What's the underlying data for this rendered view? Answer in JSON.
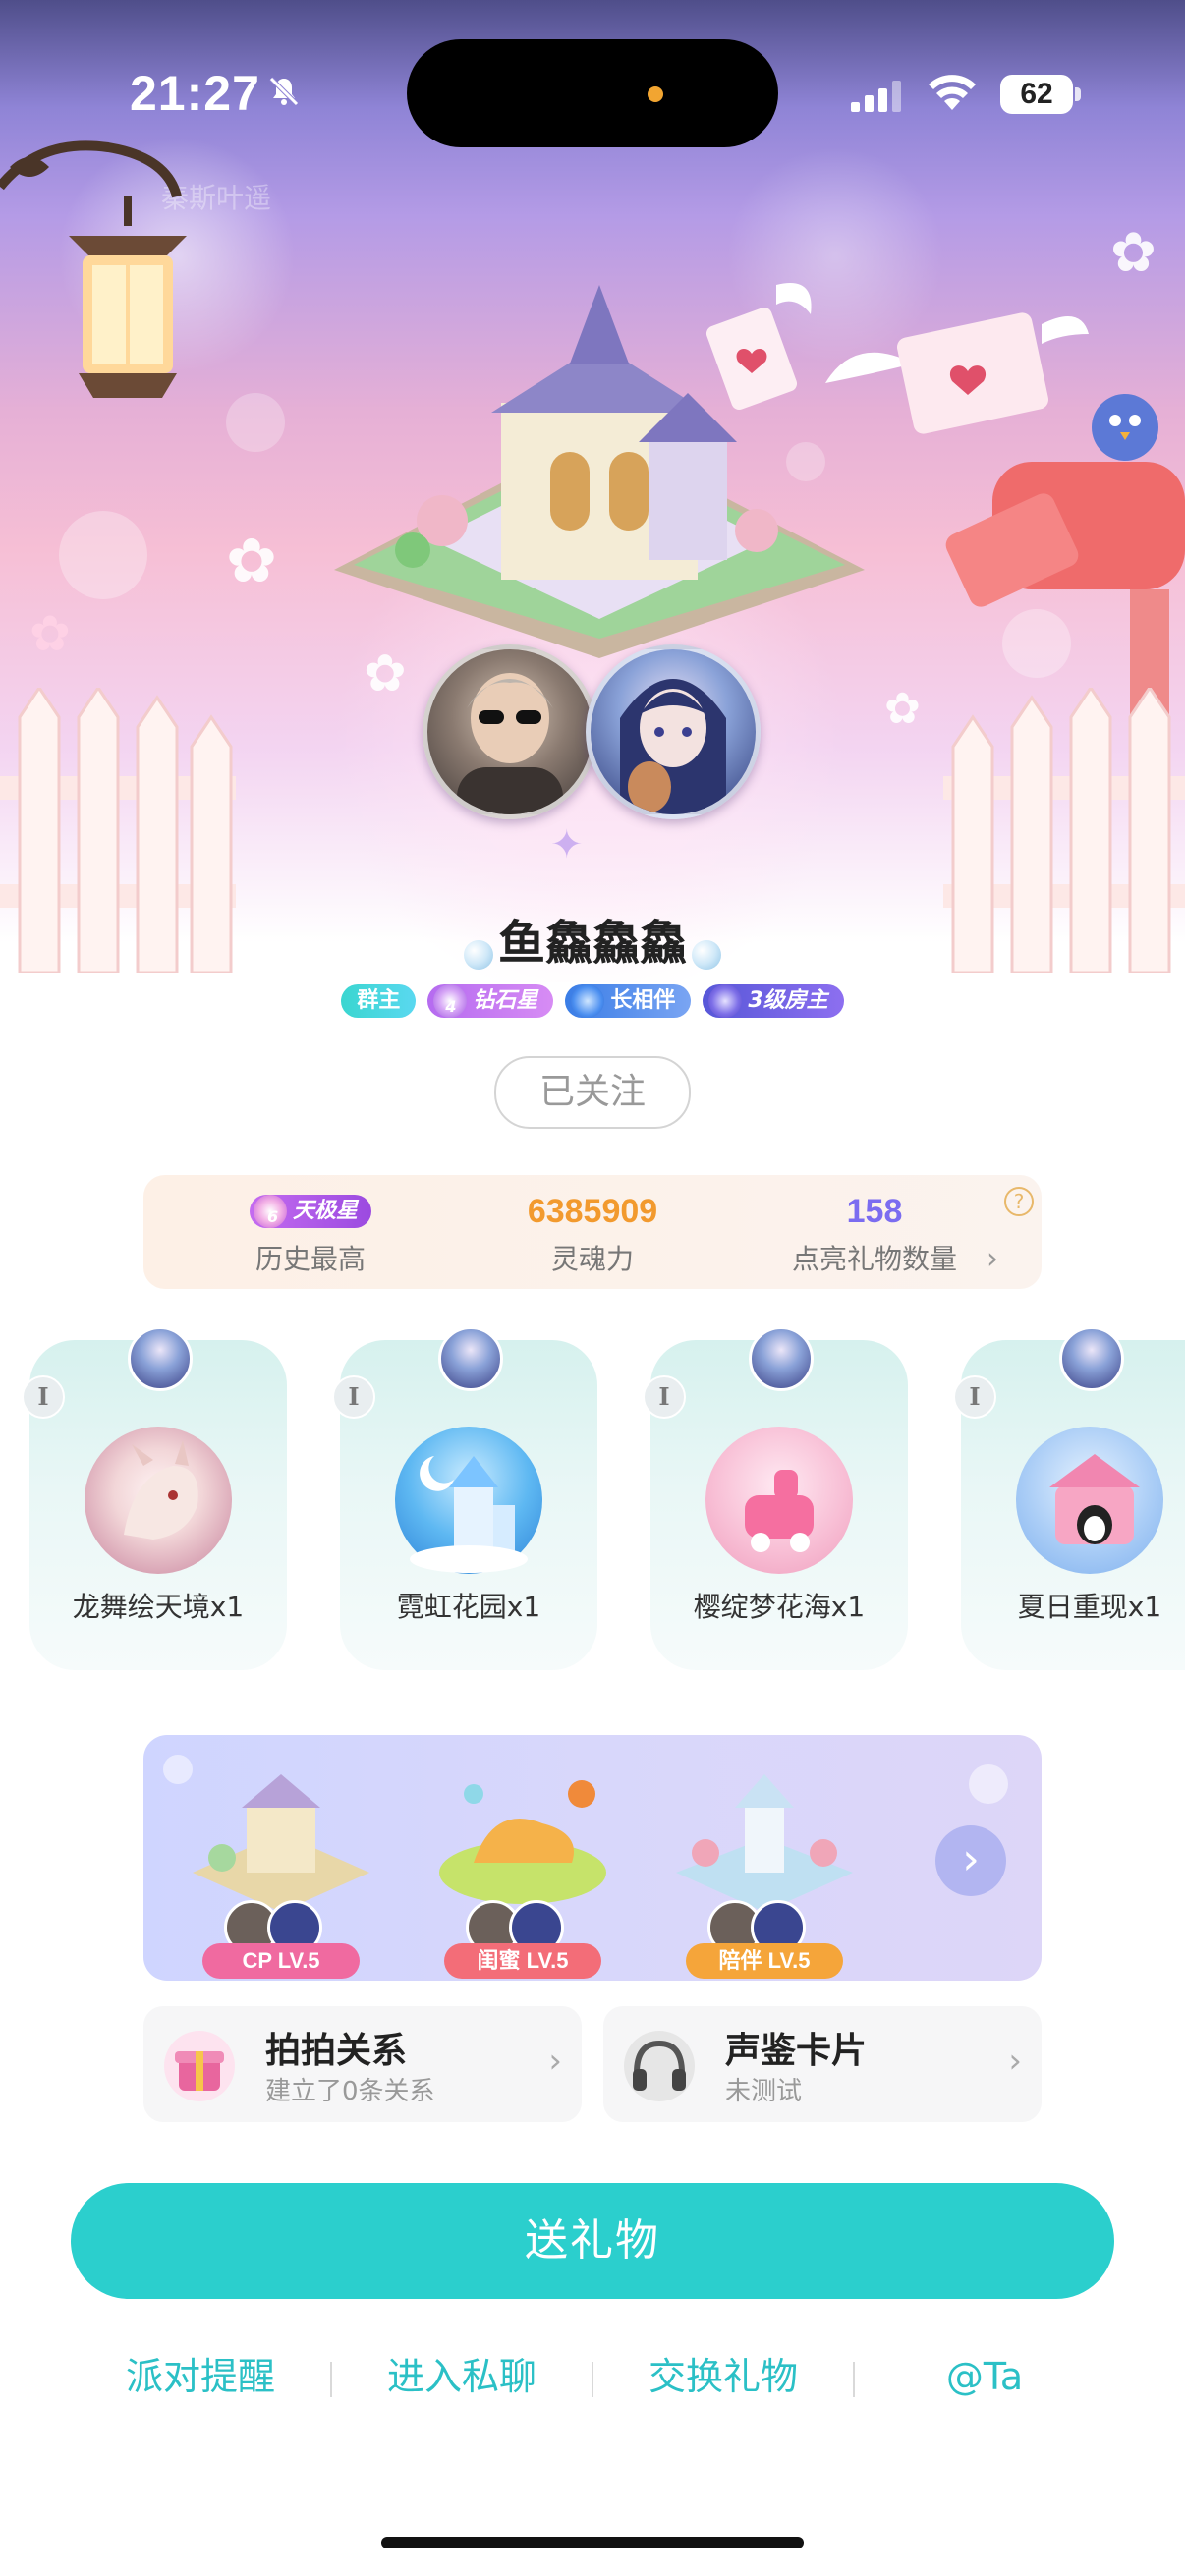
{
  "status_bar": {
    "time": "21:27",
    "battery": "62"
  },
  "faded_header_name": "秦斯叶遥",
  "profile": {
    "username": "鱼鱻鱻鱻",
    "badges": {
      "owner": "群主",
      "diamond": "钻石星",
      "diamond_level": "4",
      "partner": "长相伴",
      "house": "3级房主"
    },
    "follow_label": "已关注"
  },
  "stats": {
    "rank_badge": "天极星",
    "rank_level": "6",
    "rank_label": "历史最高",
    "soul_value": "6385909",
    "soul_label": "灵魂力",
    "gift_count": "158",
    "gift_count_label": "点亮礼物数量",
    "help": "?",
    "chevron": "›"
  },
  "gifts": [
    {
      "rank": "I",
      "name": "龙舞绘天境x1"
    },
    {
      "rank": "I",
      "name": "霓虹花园x1"
    },
    {
      "rank": "I",
      "name": "樱绽梦花海x1"
    },
    {
      "rank": "I",
      "name": "夏日重现x1"
    }
  ],
  "relations": [
    {
      "label": "CP LV.5",
      "color": "#f06aa0"
    },
    {
      "label": "闺蜜 LV.5",
      "color": "#f36d78"
    },
    {
      "label": "陪伴 LV.5",
      "color": "#f5a53a"
    }
  ],
  "relations_next": "›",
  "cards": {
    "paipai": {
      "title": "拍拍关系",
      "subtitle": "建立了0条关系",
      "chevron": "›"
    },
    "voice": {
      "title": "声鉴卡片",
      "subtitle": "未测试",
      "chevron": "›"
    }
  },
  "send_gift_label": "送礼物",
  "bottom_links": [
    "派对提醒",
    "进入私聊",
    "交换礼物",
    "@Ta"
  ],
  "colors": {
    "accent": "#2bcfcd",
    "link": "#2bc0c6",
    "orange": "#f29a2e",
    "purple": "#7b6cf0"
  }
}
